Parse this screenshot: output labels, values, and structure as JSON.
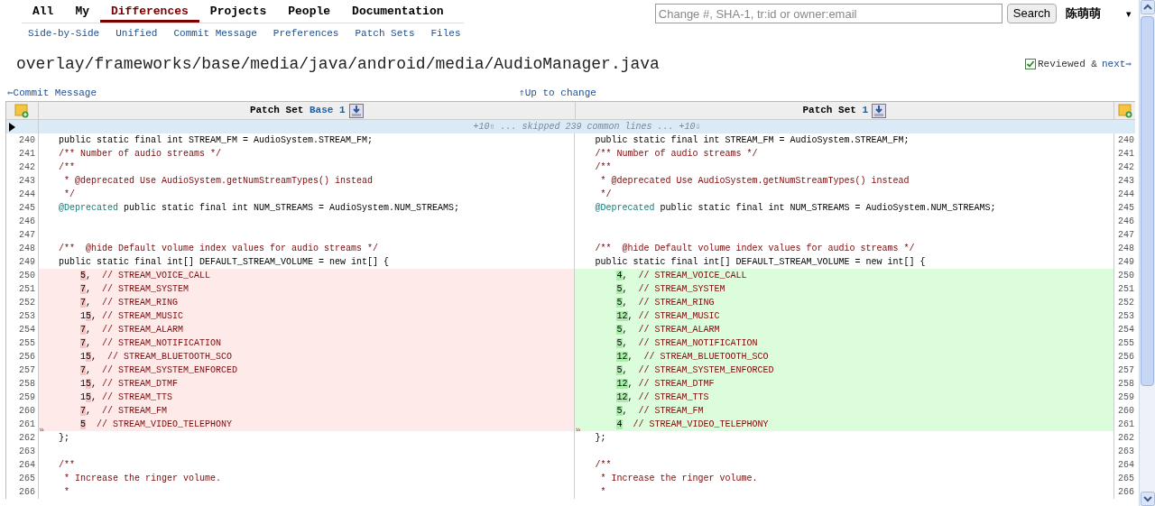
{
  "nav": {
    "tabs": [
      {
        "label": "All",
        "selected": false
      },
      {
        "label": "My",
        "selected": false
      },
      {
        "label": "Differences",
        "selected": true
      },
      {
        "label": "Projects",
        "selected": false
      },
      {
        "label": "People",
        "selected": false
      },
      {
        "label": "Documentation",
        "selected": false
      }
    ],
    "subtabs": [
      "Side-by-Side",
      "Unified",
      "Commit Message",
      "Preferences",
      "Patch Sets",
      "Files"
    ],
    "search": {
      "placeholder": "Change #, SHA-1, tr:id or owner:email",
      "button": "Search"
    },
    "user": "陈萌萌",
    "user_caret": "▾"
  },
  "file_path": "overlay/frameworks/base/media/java/android/media/AudioManager.java",
  "reviewed": {
    "checked": true,
    "label": "Reviewed &",
    "link": "next⇒"
  },
  "links": {
    "back": "⇐Commit Message",
    "up": "⇑Up to change"
  },
  "diff": {
    "headers": [
      {
        "label": "Patch Set",
        "link": "Base 1"
      },
      {
        "label": "Patch Set",
        "link": "1"
      }
    ],
    "skipped": "+10⇧ ... skipped 239 common lines ... +10⇩",
    "rows": [
      {
        "kind": "context",
        "left_number": "240",
        "right_number": "240",
        "left": [
          {
            "kind": "code",
            "text": "public static final int STREAM_FM = AudioSystem.STREAM_FM;"
          }
        ],
        "right": [
          {
            "kind": "code",
            "text": "public static final int STREAM_FM = AudioSystem.STREAM_FM;"
          }
        ]
      },
      {
        "kind": "context",
        "left_number": "241",
        "right_number": "241",
        "left": [
          {
            "kind": "comment",
            "text": "/** Number of audio streams */"
          }
        ],
        "right": [
          {
            "kind": "comment",
            "text": "/** Number of audio streams */"
          }
        ]
      },
      {
        "kind": "context",
        "left_number": "242",
        "right_number": "242",
        "left": [
          {
            "kind": "comment",
            "text": "/**"
          }
        ],
        "right": [
          {
            "kind": "comment",
            "text": "/**"
          }
        ]
      },
      {
        "kind": "context",
        "left_number": "243",
        "right_number": "243",
        "left": [
          {
            "kind": "comment",
            "text": " * @deprecated Use AudioSystem.getNumStreamTypes() instead"
          }
        ],
        "right": [
          {
            "kind": "comment",
            "text": " * @deprecated Use AudioSystem.getNumStreamTypes() instead"
          }
        ]
      },
      {
        "kind": "context",
        "left_number": "244",
        "right_number": "244",
        "left": [
          {
            "kind": "comment",
            "text": " */"
          }
        ],
        "right": [
          {
            "kind": "comment",
            "text": " */"
          }
        ]
      },
      {
        "kind": "context",
        "left_number": "245",
        "right_number": "245",
        "left": [
          {
            "kind": "annotation",
            "text": "@Deprecated"
          },
          {
            "kind": "code",
            "text": " public static final int NUM_STREAMS = AudioSystem.NUM_STREAMS;"
          }
        ],
        "right": [
          {
            "kind": "annotation",
            "text": "@Deprecated"
          },
          {
            "kind": "code",
            "text": " public static final int NUM_STREAMS = AudioSystem.NUM_STREAMS;"
          }
        ]
      },
      {
        "kind": "context",
        "left_number": "246",
        "right_number": "246"
      },
      {
        "kind": "context",
        "left_number": "247",
        "right_number": "247"
      },
      {
        "kind": "context",
        "left_number": "248",
        "right_number": "248",
        "left": [
          {
            "kind": "comment",
            "text": "/**  @hide Default volume index values for audio streams */"
          }
        ],
        "right": [
          {
            "kind": "comment",
            "text": "/**  @hide Default volume index values for audio streams */"
          }
        ]
      },
      {
        "kind": "context",
        "left_number": "249",
        "right_number": "249",
        "left": [
          {
            "kind": "code",
            "text": "public static final int[] DEFAULT_STREAM_VOLUME = new int[] {"
          }
        ],
        "right": [
          {
            "kind": "code",
            "text": "public static final int[] DEFAULT_STREAM_VOLUME = new int[] {"
          }
        ]
      },
      {
        "kind": "changed",
        "left_number": "250",
        "right_number": "250",
        "left": [
          {
            "kind": "edit",
            "text": "5"
          },
          {
            "kind": "code",
            "text": ","
          },
          {
            "kind": "comment",
            "text": "  // STREAM_VOICE_CALL"
          }
        ],
        "right": [
          {
            "kind": "edit",
            "text": "4"
          },
          {
            "kind": "code",
            "text": ","
          },
          {
            "kind": "comment",
            "text": "  // STREAM_VOICE_CALL"
          }
        ]
      },
      {
        "kind": "changed",
        "left_number": "251",
        "right_number": "251",
        "left": [
          {
            "kind": "edit",
            "text": "7"
          },
          {
            "kind": "code",
            "text": ","
          },
          {
            "kind": "comment",
            "text": "  // STREAM_SYSTEM"
          }
        ],
        "right": [
          {
            "kind": "edit",
            "text": "5"
          },
          {
            "kind": "code",
            "text": ","
          },
          {
            "kind": "comment",
            "text": "  // STREAM_SYSTEM"
          }
        ]
      },
      {
        "kind": "changed",
        "left_number": "252",
        "right_number": "252",
        "left": [
          {
            "kind": "edit",
            "text": "7"
          },
          {
            "kind": "code",
            "text": ","
          },
          {
            "kind": "comment",
            "text": "  // STREAM_RING"
          }
        ],
        "right": [
          {
            "kind": "edit",
            "text": "5"
          },
          {
            "kind": "code",
            "text": ","
          },
          {
            "kind": "comment",
            "text": "  // STREAM_RING"
          }
        ]
      },
      {
        "kind": "changed",
        "left_number": "253",
        "right_number": "253",
        "left": [
          {
            "kind": "code",
            "text": "1"
          },
          {
            "kind": "edit",
            "text": "5"
          },
          {
            "kind": "code",
            "text": ","
          },
          {
            "kind": "comment",
            "text": " // STREAM_MUSIC"
          }
        ],
        "right": [
          {
            "kind": "edit",
            "text": "12"
          },
          {
            "kind": "code",
            "text": ","
          },
          {
            "kind": "comment",
            "text": " // STREAM_MUSIC"
          }
        ]
      },
      {
        "kind": "changed",
        "left_number": "254",
        "right_number": "254",
        "left": [
          {
            "kind": "edit",
            "text": "7"
          },
          {
            "kind": "code",
            "text": ","
          },
          {
            "kind": "comment",
            "text": "  // STREAM_ALARM"
          }
        ],
        "right": [
          {
            "kind": "edit",
            "text": "5"
          },
          {
            "kind": "code",
            "text": ","
          },
          {
            "kind": "comment",
            "text": "  // STREAM_ALARM"
          }
        ]
      },
      {
        "kind": "changed",
        "left_number": "255",
        "right_number": "255",
        "left": [
          {
            "kind": "edit",
            "text": "7"
          },
          {
            "kind": "code",
            "text": ","
          },
          {
            "kind": "comment",
            "text": "  // STREAM_NOTIFICATION"
          }
        ],
        "right": [
          {
            "kind": "edit",
            "text": "5"
          },
          {
            "kind": "code",
            "text": ","
          },
          {
            "kind": "comment",
            "text": "  // STREAM_NOTIFICATION"
          }
        ]
      },
      {
        "kind": "changed",
        "left_number": "256",
        "right_number": "256",
        "left": [
          {
            "kind": "code",
            "text": "1"
          },
          {
            "kind": "edit",
            "text": "5"
          },
          {
            "kind": "code",
            "text": ","
          },
          {
            "kind": "comment",
            "text": "  // STREAM_BLUETOOTH_SCO"
          }
        ],
        "right": [
          {
            "kind": "edit",
            "text": "12"
          },
          {
            "kind": "code",
            "text": ","
          },
          {
            "kind": "comment",
            "text": "  // STREAM_BLUETOOTH_SCO"
          }
        ]
      },
      {
        "kind": "changed",
        "left_number": "257",
        "right_number": "257",
        "left": [
          {
            "kind": "edit",
            "text": "7"
          },
          {
            "kind": "code",
            "text": ","
          },
          {
            "kind": "comment",
            "text": "  // STREAM_SYSTEM_ENFORCED"
          }
        ],
        "right": [
          {
            "kind": "edit",
            "text": "5"
          },
          {
            "kind": "code",
            "text": ","
          },
          {
            "kind": "comment",
            "text": "  // STREAM_SYSTEM_ENFORCED"
          }
        ]
      },
      {
        "kind": "changed",
        "left_number": "258",
        "right_number": "258",
        "left": [
          {
            "kind": "code",
            "text": "1"
          },
          {
            "kind": "edit",
            "text": "5"
          },
          {
            "kind": "code",
            "text": ","
          },
          {
            "kind": "comment",
            "text": " // STREAM_DTMF"
          }
        ],
        "right": [
          {
            "kind": "edit",
            "text": "12"
          },
          {
            "kind": "code",
            "text": ","
          },
          {
            "kind": "comment",
            "text": " // STREAM_DTMF"
          }
        ]
      },
      {
        "kind": "changed",
        "left_number": "259",
        "right_number": "259",
        "left": [
          {
            "kind": "code",
            "text": "1"
          },
          {
            "kind": "edit",
            "text": "5"
          },
          {
            "kind": "code",
            "text": ","
          },
          {
            "kind": "comment",
            "text": " // STREAM_TTS"
          }
        ],
        "right": [
          {
            "kind": "edit",
            "text": "12"
          },
          {
            "kind": "code",
            "text": ","
          },
          {
            "kind": "comment",
            "text": " // STREAM_TTS"
          }
        ]
      },
      {
        "kind": "changed",
        "left_number": "260",
        "right_number": "260",
        "left": [
          {
            "kind": "edit",
            "text": "7"
          },
          {
            "kind": "code",
            "text": ","
          },
          {
            "kind": "comment",
            "text": "  // STREAM_FM"
          }
        ],
        "right": [
          {
            "kind": "edit",
            "text": "5"
          },
          {
            "kind": "code",
            "text": ","
          },
          {
            "kind": "comment",
            "text": "  // STREAM_FM"
          }
        ]
      },
      {
        "kind": "changed",
        "left_number": "261",
        "right_number": "261",
        "left_marker": "»",
        "right_marker": "»",
        "left": [
          {
            "kind": "edit",
            "text": "5"
          },
          {
            "kind": "comment",
            "text": "  // STREAM_VIDEO_TELEPHONY"
          }
        ],
        "right": [
          {
            "kind": "edit",
            "text": "4"
          },
          {
            "kind": "comment",
            "text": "  // STREAM_VIDEO_TELEPHONY"
          }
        ]
      },
      {
        "kind": "context",
        "left_number": "262",
        "right_number": "262",
        "left": [
          {
            "kind": "code",
            "text": "};"
          }
        ],
        "right": [
          {
            "kind": "code",
            "text": "};"
          }
        ]
      },
      {
        "kind": "context",
        "left_number": "263",
        "right_number": "263"
      },
      {
        "kind": "context",
        "left_number": "264",
        "right_number": "264",
        "left": [
          {
            "kind": "comment",
            "text": "/**"
          }
        ],
        "right": [
          {
            "kind": "comment",
            "text": "/**"
          }
        ]
      },
      {
        "kind": "context",
        "left_number": "265",
        "right_number": "265",
        "left": [
          {
            "kind": "comment",
            "text": " * Increase the ringer volume."
          }
        ],
        "right": [
          {
            "kind": "comment",
            "text": " * Increase the ringer volume."
          }
        ]
      },
      {
        "kind": "context",
        "left_number": "266",
        "right_number": "266",
        "left": [
          {
            "kind": "comment",
            "text": " *"
          }
        ],
        "right": [
          {
            "kind": "comment",
            "text": " *"
          }
        ]
      }
    ]
  }
}
